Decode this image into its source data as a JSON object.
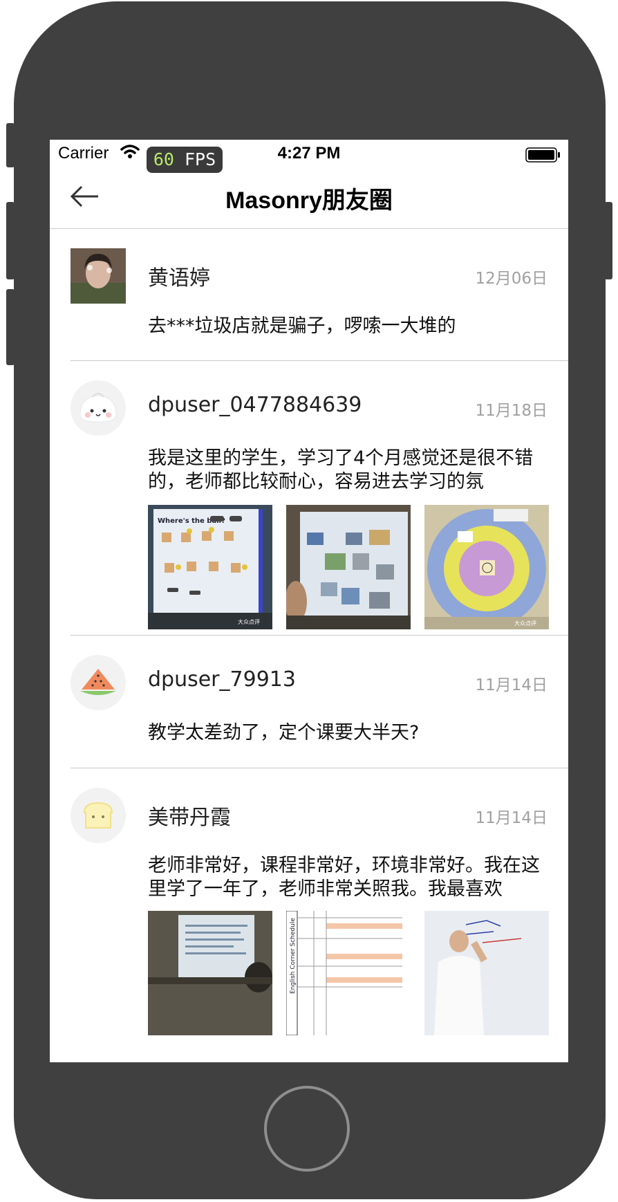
{
  "status_bar": {
    "carrier": "Carrier",
    "fps_value": "60",
    "fps_unit": "FPS",
    "time": "4:27 PM"
  },
  "nav": {
    "title": "Masonry朋友圈"
  },
  "posts": [
    {
      "username": "黄语婷",
      "date": "12月06日",
      "content": "去***垃圾店就是骗子，啰嗦一大堆的",
      "avatar_icon": "user-photo-avatar",
      "photo_count": 0
    },
    {
      "username": "dpuser_0477884639",
      "date": "11月18日",
      "content": "我是这里的学生，学习了4个月感觉还是很不错的，老师都比较耐心，容易进去学习的氛",
      "avatar_icon": "bun-avatar",
      "photo_count": 3
    },
    {
      "username": "dpuser_79913",
      "date": "11月14日",
      "content": "教学太差劲了，定个课要大半天?",
      "avatar_icon": "watermelon-avatar",
      "photo_count": 0
    },
    {
      "username": "美带丹霞",
      "date": "11月14日",
      "content": "老师非常好，课程非常好，环境非常好。我在这里学了一年了，老师非常关照我。我最喜欢",
      "avatar_icon": "toast-avatar",
      "photo_count": 3
    }
  ],
  "photo_text": {
    "p1_title": "Where's the ball?",
    "watermark": "大众点评",
    "p6_title": "English Corner Schedule"
  },
  "colors": {
    "frame": "#404040",
    "divider": "#c8c8c8",
    "date_gray": "#a0a0a0",
    "fps_green": "#b7e86b"
  }
}
